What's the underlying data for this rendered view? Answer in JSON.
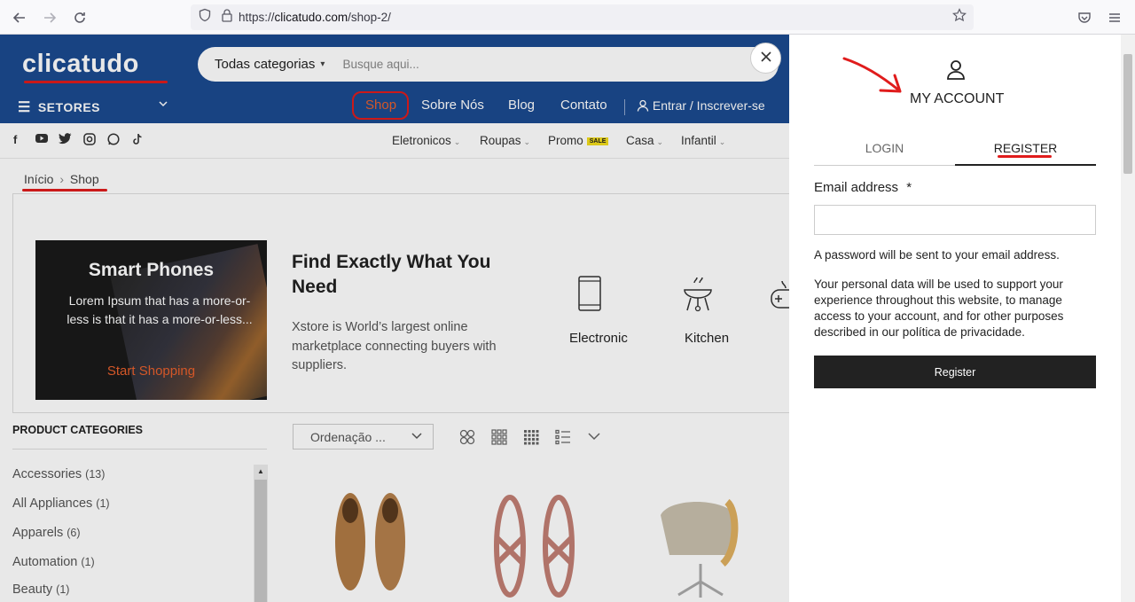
{
  "browser": {
    "url_prefix": "https://",
    "url_host": "clicatudo.com",
    "url_path": "/shop-2/"
  },
  "header": {
    "logo": "clicatudo",
    "search_category": "Todas categorias",
    "search_placeholder": "Busque aqui...",
    "setores": "SETORES",
    "nav": [
      "Shop",
      "Sobre Nós",
      "Blog",
      "Contato"
    ],
    "login_link": "Entrar / Inscrever-se"
  },
  "categories_bar": {
    "items": [
      "Eletronicos",
      "Roupas",
      "Promo",
      "Casa",
      "Infantil"
    ],
    "sale_badge": "SALE"
  },
  "breadcrumb": {
    "home": "Início",
    "current": "Shop"
  },
  "promo": {
    "banner_title": "Smart Phones",
    "banner_text": "Lorem Ipsum that has a more-or-less is that it has a more-or-less...",
    "banner_cta": "Start Shopping",
    "heading": "Find Exactly What You Need",
    "description": "Xstore is World’s largest online marketplace connecting buyers with suppliers.",
    "features": [
      "Electronic",
      "Kitchen"
    ]
  },
  "sidebar": {
    "title": "PRODUCT CATEGORIES",
    "items": [
      {
        "label": "Accessories",
        "count": "(13)"
      },
      {
        "label": "All Appliances",
        "count": "(1)"
      },
      {
        "label": "Apparels",
        "count": "(6)"
      },
      {
        "label": "Automation",
        "count": "(1)"
      },
      {
        "label": "Beauty",
        "count": "(1)"
      }
    ]
  },
  "toolbar": {
    "sort_label": "Ordenação ..."
  },
  "account_panel": {
    "title": "MY ACCOUNT",
    "tab_login": "LOGIN",
    "tab_register": "REGISTER",
    "email_label": "Email address",
    "required_mark": "*",
    "email_value": "",
    "password_note": "A password will be sent to your email address.",
    "privacy_text": "Your personal data will be used to support your experience throughout this website, to manage access to your account, and for other purposes described in our política de privacidade.",
    "register_button": "Register"
  },
  "colors": {
    "header_blue": "#1b4a8f",
    "annotation_red": "#e01c1c",
    "cta_orange": "#e8602c",
    "button_dark": "#222222",
    "sale_yellow": "#f2dc1b"
  }
}
